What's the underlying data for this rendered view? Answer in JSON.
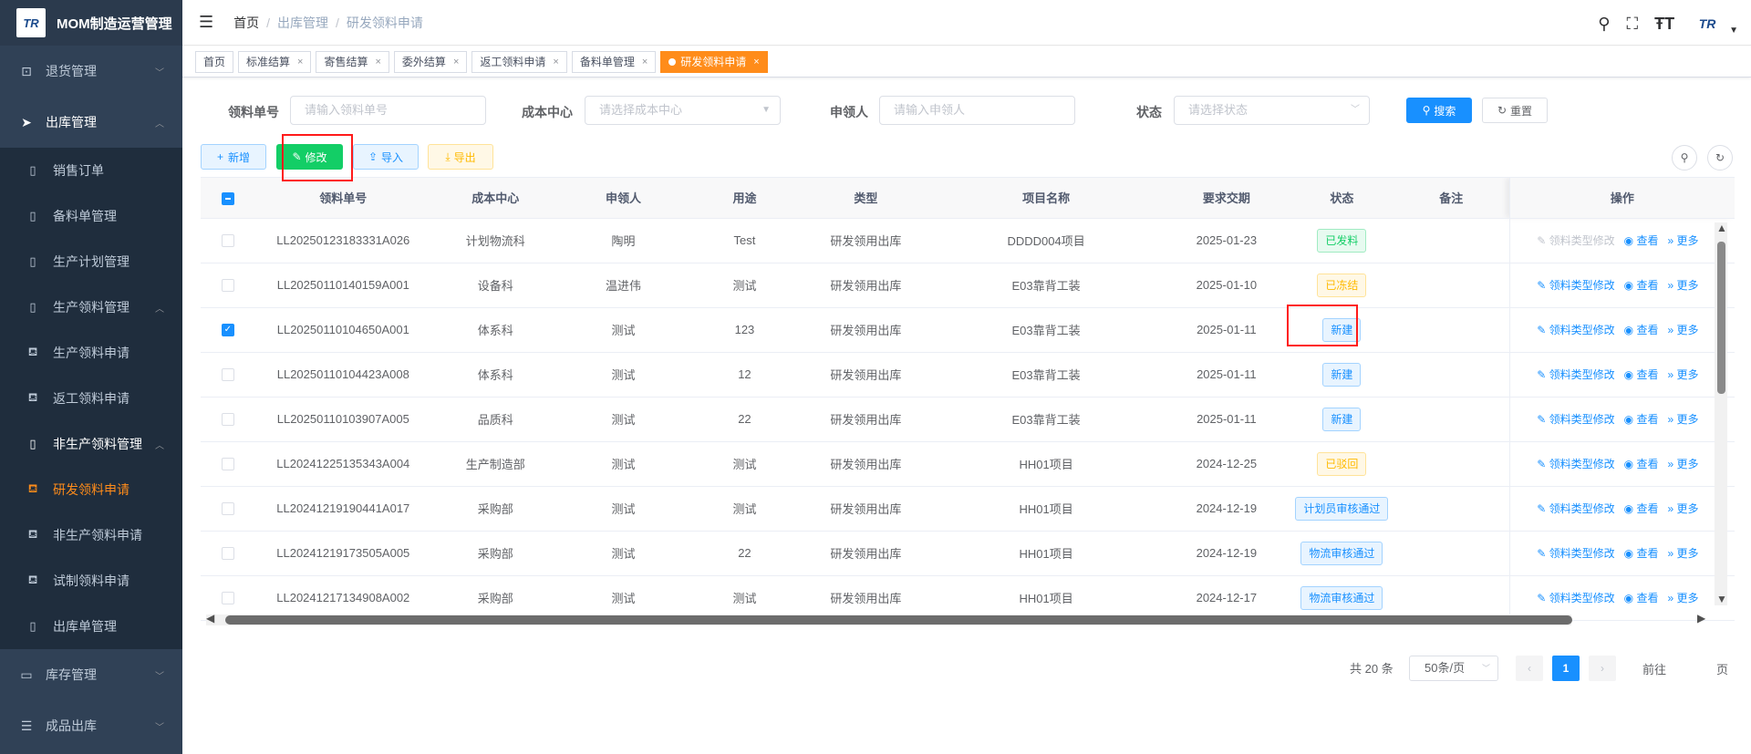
{
  "app": {
    "logo_text": "TR",
    "title": "MOM制造运营管理"
  },
  "sidebar": {
    "items": [
      {
        "label": "退货管理"
      },
      {
        "label": "出库管理"
      },
      {
        "label": "销售订单"
      },
      {
        "label": "备料单管理"
      },
      {
        "label": "生产计划管理"
      },
      {
        "label": "生产领料管理"
      },
      {
        "label": "生产领料申请"
      },
      {
        "label": "返工领料申请"
      },
      {
        "label": "非生产领料管理"
      },
      {
        "label": "研发领料申请"
      },
      {
        "label": "非生产领料申请"
      },
      {
        "label": "试制领料申请"
      },
      {
        "label": "出库单管理"
      },
      {
        "label": "库存管理"
      },
      {
        "label": "成品出库"
      }
    ]
  },
  "header": {
    "breadcrumb": [
      "首页",
      "出库管理",
      "研发领料申请"
    ],
    "avatar_text": "TR"
  },
  "tabs": [
    {
      "label": "首页"
    },
    {
      "label": "标准结算"
    },
    {
      "label": "寄售结算"
    },
    {
      "label": "委外结算"
    },
    {
      "label": "返工领料申请"
    },
    {
      "label": "备料单管理"
    },
    {
      "label": "研发领料申请"
    }
  ],
  "search": {
    "order_no_label": "领料单号",
    "order_no_placeholder": "请输入领料单号",
    "cost_center_label": "成本中心",
    "cost_center_placeholder": "请选择成本中心",
    "applicant_label": "申领人",
    "applicant_placeholder": "请输入申领人",
    "status_label": "状态",
    "status_placeholder": "请选择状态",
    "search_button": "搜索",
    "reset_button": "重置"
  },
  "toolbar": {
    "add": "新增",
    "edit": "修改",
    "import": "导入",
    "export": "导出"
  },
  "table": {
    "columns": [
      "领料单号",
      "成本中心",
      "申领人",
      "用途",
      "类型",
      "项目名称",
      "要求交期",
      "状态",
      "备注",
      "操作"
    ],
    "op_labels": {
      "modify_type": "领料类型修改",
      "view": "查看",
      "more": "更多"
    },
    "rows": [
      {
        "order_no": "LL20250123183331A026",
        "cost_center": "计划物流科",
        "applicant": "陶明",
        "purpose": "Test",
        "type": "研发领用出库",
        "project": "DDDD004项目",
        "due": "2025-01-23",
        "status": "已发料",
        "note": ""
      },
      {
        "order_no": "LL20250110140159A001",
        "cost_center": "设备科",
        "applicant": "温进伟",
        "purpose": "测试",
        "type": "研发领用出库",
        "project": "E03靠背工装",
        "due": "2025-01-10",
        "status": "已冻结",
        "note": ""
      },
      {
        "order_no": "LL20250110104650A001",
        "cost_center": "体系科",
        "applicant": "测试",
        "purpose": "123",
        "type": "研发领用出库",
        "project": "E03靠背工装",
        "due": "2025-01-11",
        "status": "新建",
        "note": ""
      },
      {
        "order_no": "LL20250110104423A008",
        "cost_center": "体系科",
        "applicant": "测试",
        "purpose": "12",
        "type": "研发领用出库",
        "project": "E03靠背工装",
        "due": "2025-01-11",
        "status": "新建",
        "note": ""
      },
      {
        "order_no": "LL20250110103907A005",
        "cost_center": "品质科",
        "applicant": "测试",
        "purpose": "22",
        "type": "研发领用出库",
        "project": "E03靠背工装",
        "due": "2025-01-11",
        "status": "新建",
        "note": ""
      },
      {
        "order_no": "LL20241225135343A004",
        "cost_center": "生产制造部",
        "applicant": "测试",
        "purpose": "测试",
        "type": "研发领用出库",
        "project": "HH01项目",
        "due": "2024-12-25",
        "status": "已驳回",
        "note": ""
      },
      {
        "order_no": "LL20241219190441A017",
        "cost_center": "采购部",
        "applicant": "测试",
        "purpose": "测试",
        "type": "研发领用出库",
        "project": "HH01项目",
        "due": "2024-12-19",
        "status": "计划员审核通过",
        "note": ""
      },
      {
        "order_no": "LL20241219173505A005",
        "cost_center": "采购部",
        "applicant": "测试",
        "purpose": "22",
        "type": "研发领用出库",
        "project": "HH01项目",
        "due": "2024-12-19",
        "status": "物流审核通过",
        "note": ""
      },
      {
        "order_no": "LL20241217134908A002",
        "cost_center": "采购部",
        "applicant": "测试",
        "purpose": "测试",
        "type": "研发领用出库",
        "project": "HH01项目",
        "due": "2024-12-17",
        "status": "物流审核通过",
        "note": ""
      }
    ]
  },
  "pagination": {
    "total": "共 20 条",
    "page_size": "50条/页",
    "current_page": "1",
    "goto_label": "前往",
    "page_suffix": "页"
  },
  "colors": {
    "sidebar_bg": "#304156",
    "primary": "#1890ff",
    "active_orange": "#ff8c1a",
    "success_green": "#13ce66",
    "highlight_red": "#ff1a1a"
  }
}
